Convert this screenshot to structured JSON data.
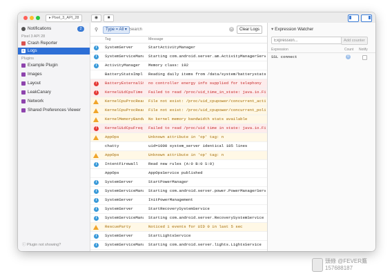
{
  "titlebar": {
    "device": "Pixel_3_API_28",
    "camera_icon": "camera-icon",
    "record_icon": "record-icon"
  },
  "sidebar": {
    "notifications": {
      "label": "Notifications",
      "badge": "2"
    },
    "device_sub": "Pixel 3 API 28",
    "items_top": [
      {
        "label": "Crash Reporter",
        "icon": "crash-icon",
        "color": "#d9534f",
        "selected": false
      },
      {
        "label": "Logs",
        "icon": "logs-icon",
        "color": "#3a7bd5",
        "selected": true
      }
    ],
    "plugins_header": "Plugins",
    "plugins": [
      {
        "label": "Example Plugin",
        "icon": "plugin-icon",
        "color": "#8e44ad"
      },
      {
        "label": "Images",
        "icon": "images-icon",
        "color": "#8e44ad"
      },
      {
        "label": "Layout",
        "icon": "layout-icon",
        "color": "#8e44ad"
      },
      {
        "label": "LeakCanary",
        "icon": "leakcanary-icon",
        "color": "#8e44ad"
      },
      {
        "label": "Network",
        "icon": "network-icon",
        "color": "#8e44ad"
      },
      {
        "label": "Shared Preferences Viewer",
        "icon": "preferences-icon",
        "color": "#8e44ad"
      }
    ],
    "footer": "Plugin not showing?"
  },
  "search": {
    "filter_label": "Type = All",
    "placeholder": "Search",
    "clear_button": "Clear Logs"
  },
  "logs": {
    "columns": {
      "tag": "Tag",
      "message": "Message"
    },
    "rows": [
      {
        "level": "info",
        "tag": "SystemServer",
        "message": "StartActivityManager"
      },
      {
        "level": "info",
        "tag": "SystemServiceManager",
        "message": "Starting com.android.server.am.ActivityManagerService$Lifecycle"
      },
      {
        "level": "info",
        "tag": "ActivityManager",
        "message": "Memory class: 192"
      },
      {
        "level": "verbose",
        "tag": "BatteryStatsImpl",
        "message": "Reading daily items from /data/system/batterystats-daily.xml"
      },
      {
        "level": "error",
        "tag": "BatteryExternalStats",
        "message": "no controller energy info supplied for telephony"
      },
      {
        "level": "error",
        "tag": "KernelUidCpuTime",
        "message": "Failed to read /proc/uid_time_in_state: java.io.FileNotFoundException"
      },
      {
        "level": "warn",
        "tag": "KernelCpuProcReader",
        "message": "File not exist: /proc/uid_cpupower/concurrent_active_time"
      },
      {
        "level": "warn",
        "tag": "KernelCpuProcReader",
        "message": "File not exist: /proc/uid_cpupower/concurrent_policy_time"
      },
      {
        "level": "warn",
        "tag": "KernelMemoryBandwidthStats",
        "message": "No kernel memory bandwidth stats available"
      },
      {
        "level": "error",
        "tag": "KernelUidCpuFreq",
        "message": "Failed to read /proc/uid time in state: java.io.FileNotFoundException"
      },
      {
        "level": "warn",
        "tag": "AppOps",
        "message": "Unknown attribute in 'op' tag: n"
      },
      {
        "level": "verbose",
        "tag": "chatty",
        "message": "uid=1000 system_server identical 185 lines"
      },
      {
        "level": "warn",
        "tag": "AppOps",
        "message": "Unknown attribute in 'op' tag: n"
      },
      {
        "level": "info",
        "tag": "IntentFirewall",
        "message": "Read new rules (A:0 B:0 S:0)"
      },
      {
        "level": "verbose",
        "tag": "AppOps",
        "message": "AppOpsService published"
      },
      {
        "level": "info",
        "tag": "SystemServer",
        "message": "StartPowerManager"
      },
      {
        "level": "info",
        "tag": "SystemServiceManager",
        "message": "Starting com.android.server.power.PowerManagerService"
      },
      {
        "level": "info",
        "tag": "SystemServer",
        "message": "InitPowerManagement"
      },
      {
        "level": "info",
        "tag": "SystemServer",
        "message": "StartRecoverySystemService"
      },
      {
        "level": "info",
        "tag": "SystemServiceManager",
        "message": "Starting com.android.server.RecoverySystemService"
      },
      {
        "level": "warn",
        "tag": "RescueParty",
        "message": "Noticed 1 events for UID 0 in last 5 sec"
      },
      {
        "level": "info",
        "tag": "SystemServer",
        "message": "StartLightsService"
      },
      {
        "level": "info",
        "tag": "SystemServiceManager",
        "message": "Starting com.android.server.lights.LightsService"
      }
    ]
  },
  "watcher": {
    "title": "Expression Watcher",
    "expression_placeholder": "Expression...",
    "add_button": "Add counter",
    "columns": {
      "expression": "Expression",
      "count": "Count",
      "notify": "Notify"
    },
    "rows": [
      {
        "expression": "SSL connect",
        "count": "0"
      }
    ]
  },
  "watermark": {
    "line1": "頭條 @FEVER鷹",
    "line2": "157688187"
  },
  "colors": {
    "accent": "#3a7bd5",
    "error": "#c62828",
    "warn": "#a36a00"
  }
}
